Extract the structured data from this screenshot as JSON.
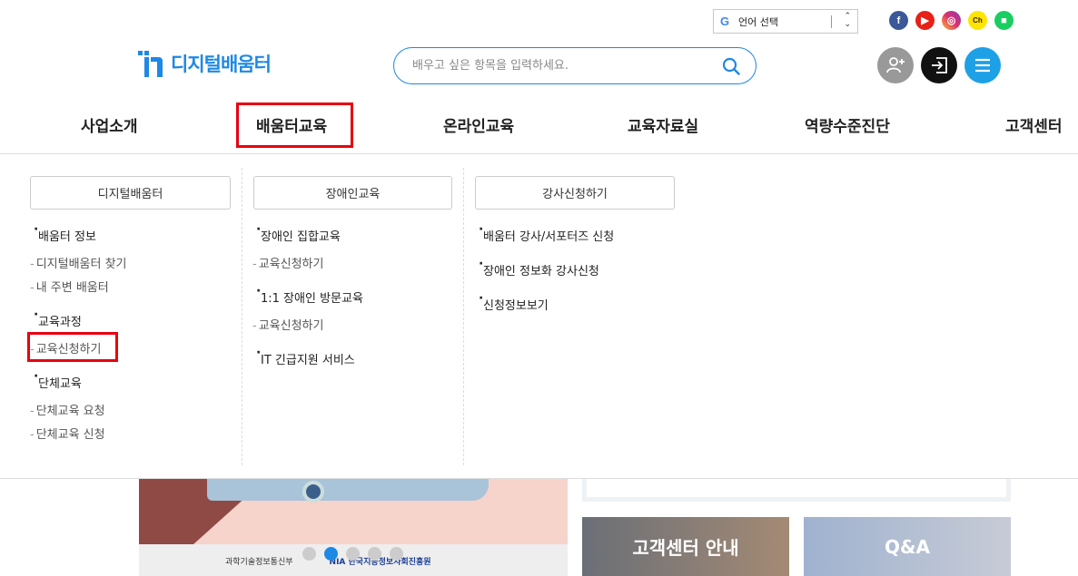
{
  "language": {
    "selected": "언어 선택"
  },
  "social": [
    "facebook-icon",
    "youtube-icon",
    "instagram-icon",
    "kakao-channel-icon",
    "naver-blog-icon"
  ],
  "social_labels": {
    "kakao": "Ch"
  },
  "logo": {
    "text": "디지털배움터"
  },
  "search": {
    "placeholder": "배우고 싶은 항목을 입력하세요."
  },
  "gnb": [
    "사업소개",
    "배움터교육",
    "온라인교육",
    "교육자료실",
    "역량수준진단",
    "고객센터"
  ],
  "dropdown": {
    "col1": {
      "title": "디지털배움터",
      "groups": [
        {
          "label": "배움터 정보",
          "items": [
            "디지털배움터 찾기",
            "내 주변 배움터"
          ]
        },
        {
          "label": "교육과정",
          "items": [
            "교육신청하기"
          ]
        },
        {
          "label": "단체교육",
          "items": [
            "단체교육 요청",
            "단체교육 신청"
          ]
        }
      ]
    },
    "col2": {
      "title": "장애인교육",
      "groups": [
        {
          "label": "장애인 집합교육",
          "items": [
            "교육신청하기"
          ]
        },
        {
          "label": "1:1 장애인 방문교육",
          "items": [
            "교육신청하기"
          ]
        },
        {
          "label": "IT 긴급지원 서비스",
          "items": []
        }
      ]
    },
    "col3": {
      "title": "강사신청하기",
      "items": [
        "배움터 강사/서포터즈 신청",
        "장애인 정보화 강사신청",
        "신청정보보기"
      ]
    }
  },
  "banner": {
    "logos": [
      "과학기술정보통신부",
      "NIA 한국지능정보사회진흥원"
    ]
  },
  "cards": [
    "고객센터 안내",
    "Q&A"
  ],
  "colors": {
    "brand": "#1e88e5",
    "highlight": "#e60012"
  }
}
